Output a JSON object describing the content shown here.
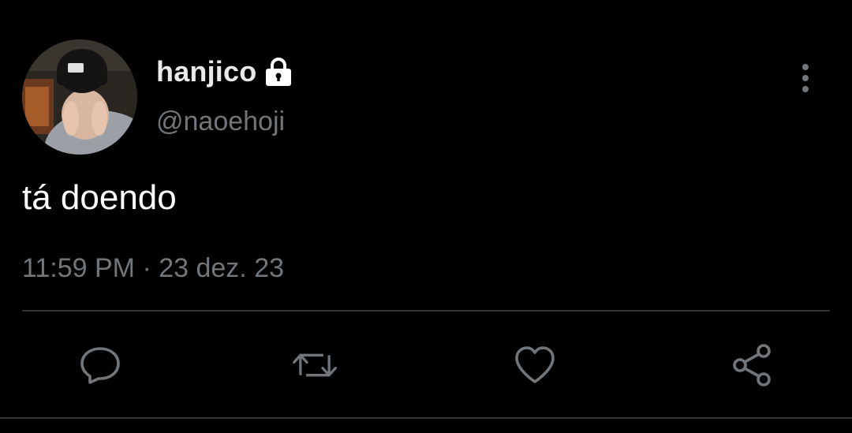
{
  "tweet": {
    "display_name": "hanjico",
    "handle": "@naoehoji",
    "text": "tá doendo",
    "timestamp": "11:59 PM · 23 dez. 23",
    "protected": true
  },
  "icons": {
    "lock": "lock-icon",
    "more": "more-vertical-icon",
    "reply": "reply-icon",
    "retweet": "retweet-icon",
    "like": "heart-icon",
    "share": "share-icon"
  },
  "colors": {
    "background": "#000000",
    "primary_text": "#e7e9ea",
    "secondary_text": "#71767b",
    "divider": "#2f3336"
  }
}
